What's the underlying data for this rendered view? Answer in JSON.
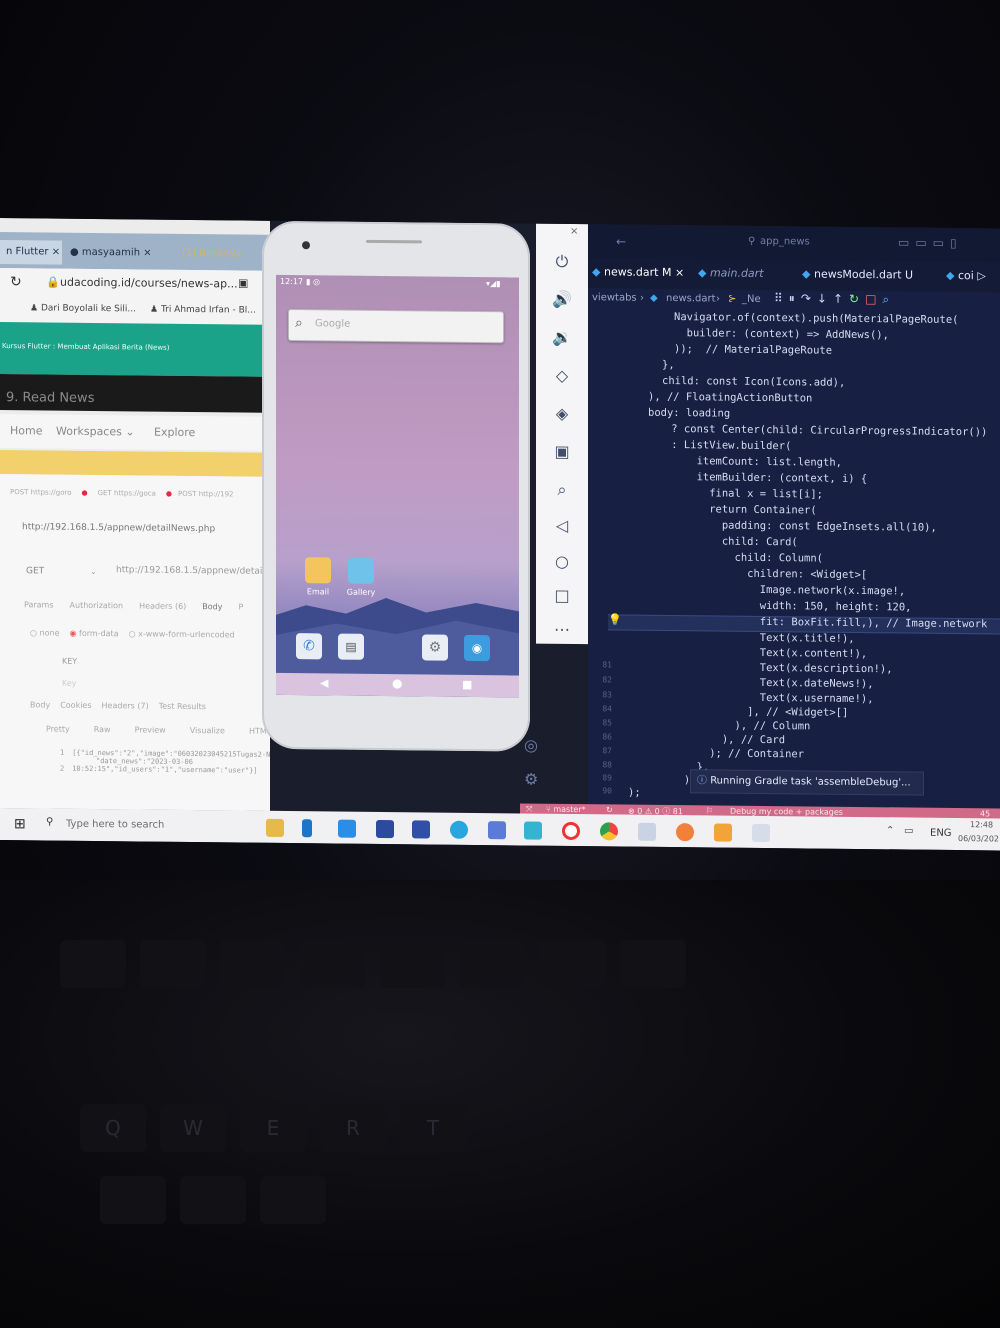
{
  "browser": {
    "tabs": [
      "n Flutter",
      "masyaamih",
      "(1) Beranda"
    ],
    "url": "udacoding.id/courses/news-ap...",
    "bookmarks": [
      "Dari Boyolali ke Sili...",
      "Tri Ahmad Irfan - Bl..."
    ],
    "course_title": "Kursus Flutter : Membuat Aplikasi Berita (News)",
    "lesson_title": "9. Read News",
    "nav": [
      "Home",
      "Workspaces",
      "Explore"
    ],
    "request_tabs": [
      "POST https://goro",
      "GET https://goca",
      "POST http://192"
    ],
    "request_title": "http://192.168.1.5/appnew/detailNews.php",
    "method": "GET",
    "request_url": "http://192.168.1.5/appnew/detailNew",
    "params_tabs": [
      "Params",
      "Authorization",
      "Headers (6)",
      "Body",
      "P"
    ],
    "body_options": [
      "none",
      "form-data",
      "x-www-form-urlencoded"
    ],
    "key_header": "KEY",
    "key_placeholder": "Key",
    "response_tabs": [
      "Body",
      "Cookies",
      "Headers (7)",
      "Test Results"
    ],
    "view_tabs": [
      "Pretty",
      "Raw",
      "Preview",
      "Visualize",
      "HTML"
    ],
    "response_line1": "[{\"id_news\":\"2\",\"image\":\"06032023045215Tugas2-NilaiMutlak.png\",\"title\":\"bismillah\",\"con",
    "response_line2": "\"date_news\":\"2023-03-06",
    "response_line3": "10:52:15\",\"id_users\":\"1\",\"username\":\"user\"}]"
  },
  "phone": {
    "time": "12:17",
    "search_placeholder": "Google",
    "apps": [
      "Email",
      "Gallery"
    ]
  },
  "vscode": {
    "window_title": "app_news",
    "tabs": [
      {
        "label": "news.dart M",
        "active": true
      },
      {
        "label": "main.dart",
        "active": false
      },
      {
        "label": "newsModel.dart U",
        "active": false
      },
      {
        "label": "coi",
        "active": false
      }
    ],
    "breadcrumb_left": "viewtabs",
    "breadcrumb_file": "news.dart",
    "breadcrumb_symbol": "_Ne",
    "line_numbers": [
      "81",
      "82",
      "83",
      "84",
      "85",
      "86",
      "87",
      "88",
      "89",
      "90"
    ],
    "code_lines": [
      "Navigator.of(context).push(MaterialPageRoute(",
      "  builder: (context) => AddNews(),",
      "));  // MaterialPageRoute",
      "},",
      "child: const Icon(Icons.add),",
      "), // FloatingActionButton",
      "body: loading",
      "    ? const Center(child: CircularProgressIndicator())",
      "    : ListView.builder(",
      "        itemCount: list.length,",
      "        itemBuilder: (context, i) {",
      "          final x = list[i];",
      "          return Container(",
      "            padding: const EdgeInsets.all(10),",
      "            child: Card(",
      "              child: Column(",
      "                children: <Widget>[",
      "                  Image.network(x.image!,",
      "                  width: 150, height: 120,",
      "                  fit: BoxFit.fill,), // Image.network",
      "                  Text(x.title!),",
      "                  Text(x.content!),",
      "                  Text(x.description!),",
      "                  Text(x.dateNews!),",
      "                  Text(x.username!),",
      "                ], // <Widget>[]",
      "              ), // Column",
      "            ), // Card",
      "          ); // Container",
      "        },",
      "      ), // ListView.builder",
      ");"
    ],
    "toast": "Running Gradle task 'assembleDebug'...",
    "status_branch": "master*",
    "status_problems": "0 ⚠ 0 ⓘ 81",
    "status_debug": "Debug my code + packages",
    "status_right": "45"
  },
  "taskbar": {
    "search_placeholder": "Type here to search",
    "lang": "ENG",
    "time": "12:48",
    "date": "06/03/202"
  },
  "keyboard_keys": [
    "Q",
    "W",
    "E",
    "R",
    "T"
  ]
}
